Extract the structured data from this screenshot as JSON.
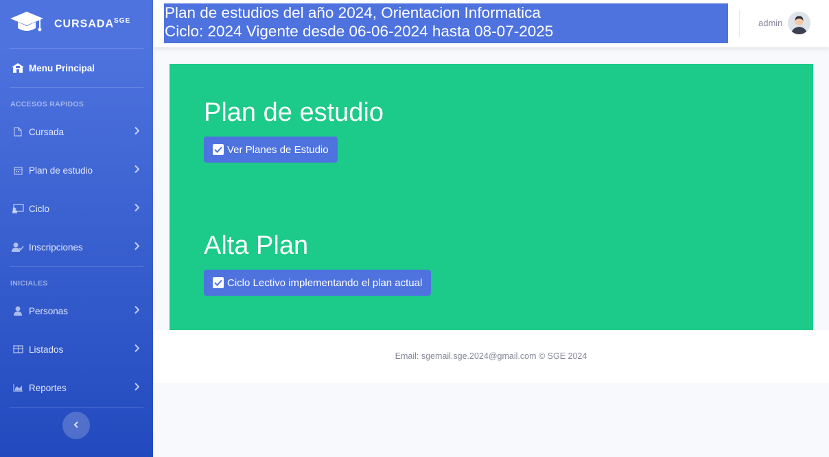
{
  "sidebar": {
    "brand": {
      "name": "CURSADA",
      "sup": "SGE",
      "icon": "graduation-cap-icon"
    },
    "main_item": {
      "label": "Menu Principal",
      "icon": "home-icon"
    },
    "headings": {
      "quick": "ACCESOS RAPIDOS",
      "initial": "INICIALES"
    },
    "quick_items": [
      {
        "label": "Cursada",
        "icon": "file-icon"
      },
      {
        "label": "Plan de estudio",
        "icon": "calendar-icon"
      },
      {
        "label": "Ciclo",
        "icon": "chalkboard-icon"
      },
      {
        "label": "Inscripciones",
        "icon": "user-check-icon"
      }
    ],
    "initial_items": [
      {
        "label": "Personas",
        "icon": "user-tie-icon"
      },
      {
        "label": "Listados",
        "icon": "table-icon"
      },
      {
        "label": "Reportes",
        "icon": "chart-area-icon"
      }
    ]
  },
  "topbar": {
    "title_line1": "Plan de estudios del año 2024, Orientacion Informatica",
    "title_line2": "Ciclo: 2024 Vigente desde 06-06-2024 hasta 08-07-2025",
    "user_name": "admin"
  },
  "content": {
    "section1_title": "Plan de estudio",
    "section1_button": "Ver Planes de Estudio",
    "section2_title": "Alta Plan",
    "section2_button": "Ciclo Lectivo implementando el plan actual"
  },
  "footer": {
    "text": "Email: sgemail.sge.2024@gmail.com © SGE 2024"
  },
  "colors": {
    "primary": "#4e73df",
    "card": "#1cca89"
  }
}
